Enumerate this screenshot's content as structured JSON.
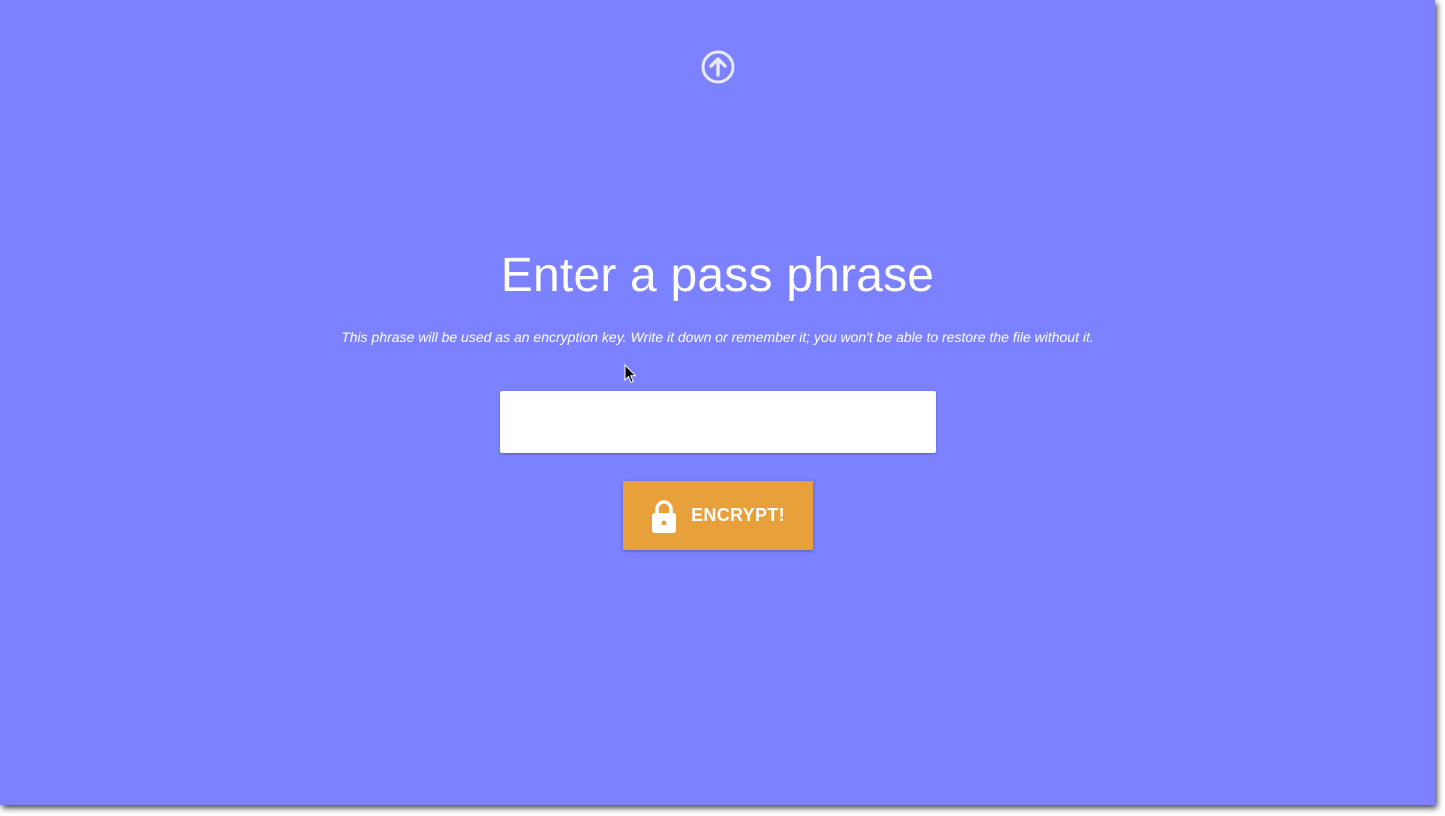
{
  "page": {
    "title": "Enter a pass phrase",
    "subtitle": "This phrase will be used as an encryption key. Write it down or remember it; you won't be able to restore the file without it."
  },
  "passphrase": {
    "value": "",
    "placeholder": ""
  },
  "encrypt_button": {
    "label": "ENCRYPT!",
    "icon": "lock-icon"
  },
  "up_button": {
    "icon": "arrow-up-circle-icon"
  },
  "colors": {
    "background": "#7b81ff",
    "button": "#e8a03a",
    "text": "#ffffff"
  }
}
